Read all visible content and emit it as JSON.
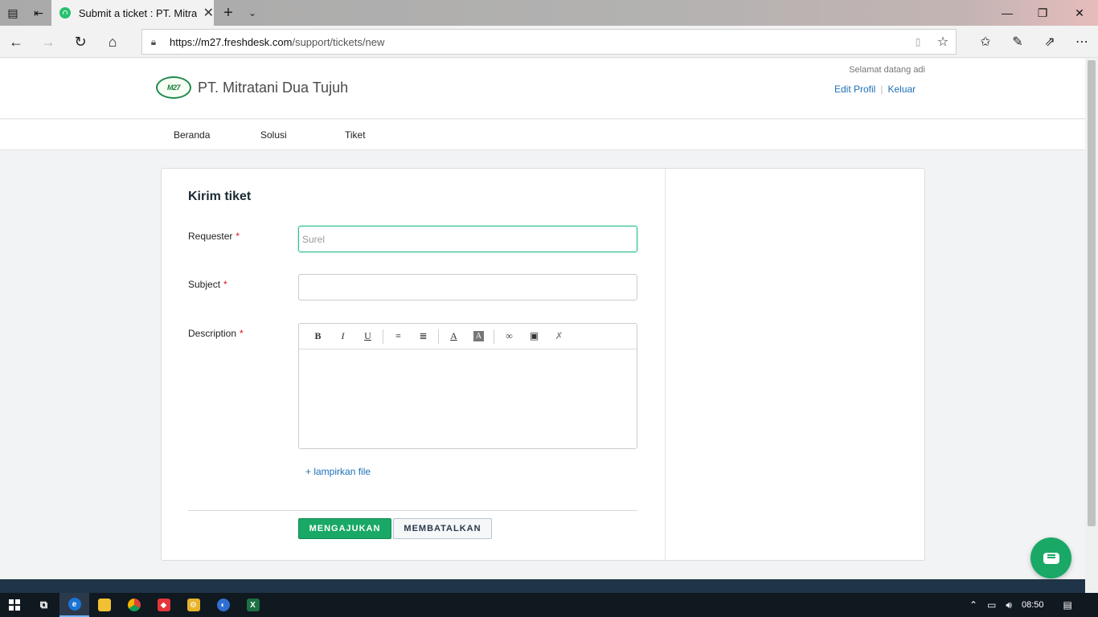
{
  "browser": {
    "tab_title": "Submit a ticket : PT. Mitratani Dua Tujuh",
    "url_host": "https://m27.freshdesk.com",
    "url_path": "/support/tickets/new"
  },
  "header": {
    "logo_text": "M27",
    "company_name": "PT. Mitratani Dua Tujuh",
    "welcome": "Selamat datang adi",
    "edit_profile": "Edit Profil",
    "logout": "Keluar"
  },
  "nav": {
    "items": [
      {
        "label": "Beranda"
      },
      {
        "label": "Solusi"
      },
      {
        "label": "Tiket"
      }
    ]
  },
  "form": {
    "title": "Kirim tiket",
    "requester_label": "Requester",
    "requester_placeholder": "Surel",
    "requester_value": "",
    "subject_label": "Subject",
    "subject_value": "",
    "description_label": "Description",
    "required_mark": "*",
    "attach_label": "+ lampirkan file",
    "submit_label": "MENGAJUKAN",
    "cancel_label": "MEMBATALKAN"
  },
  "editor_toolbar": [
    {
      "name": "bold-icon",
      "glyph": "B"
    },
    {
      "name": "italic-icon",
      "glyph": "I"
    },
    {
      "name": "underline-icon",
      "glyph": "U"
    },
    {
      "name": "bullet-list-icon",
      "glyph": "≡"
    },
    {
      "name": "numbered-list-icon",
      "glyph": "≣"
    },
    {
      "name": "font-color-icon",
      "glyph": "A"
    },
    {
      "name": "background-color-icon",
      "glyph": "A"
    },
    {
      "name": "link-icon",
      "glyph": "∞"
    },
    {
      "name": "image-icon",
      "glyph": "▣"
    },
    {
      "name": "remove-format-icon",
      "glyph": "✗"
    }
  ],
  "taskbar": {
    "time": "08:50"
  },
  "colors": {
    "accent_green": "#19a865",
    "link_blue": "#1d70b7",
    "footer_navy": "#1f3447"
  }
}
